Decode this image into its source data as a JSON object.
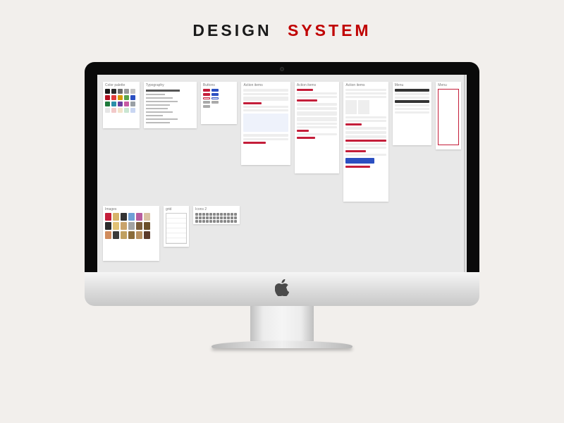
{
  "title": {
    "word1": "DESIGN",
    "word2": "SYSTEM"
  },
  "artboards": {
    "row1": [
      {
        "label": "Color palette"
      },
      {
        "label": "Typography"
      },
      {
        "label": "Buttons"
      },
      {
        "label": "Action items"
      },
      {
        "label": "Action items"
      },
      {
        "label": "Action items"
      },
      {
        "label": "Menu"
      }
    ],
    "row2": [
      {
        "label": "Images"
      },
      {
        "label": "grid"
      },
      {
        "label": "Icons 2"
      }
    ]
  },
  "palette_colors": [
    "#1a1a1a",
    "#2b2b2b",
    "#6b6b6b",
    "#9a9a9a",
    "#c4c4c4",
    "#b30f1f",
    "#e03a3a",
    "#d89a00",
    "#5aa34a",
    "#2b4fc1",
    "#1f7a3c",
    "#2b8fa8",
    "#6b3fa0",
    "#c75aa3",
    "#9aa0a6",
    "#e6e6e6",
    "#f2c9c9",
    "#f2e3c9",
    "#c9e6d2",
    "#c9d6f2"
  ],
  "image_thumbs": [
    "#c41e3a",
    "#d7b36a",
    "#333333",
    "#6fa0d6",
    "#b85c9e",
    "#d9c2a3",
    "#2b2b2b",
    "#e2c275",
    "#c9a36b",
    "#a3a3a3",
    "#7a5c3a",
    "#6b4f2a",
    "#d08b5c",
    "#3a3a3a",
    "#c0a060",
    "#8a6b3a",
    "#b89060",
    "#5c3a2a"
  ]
}
